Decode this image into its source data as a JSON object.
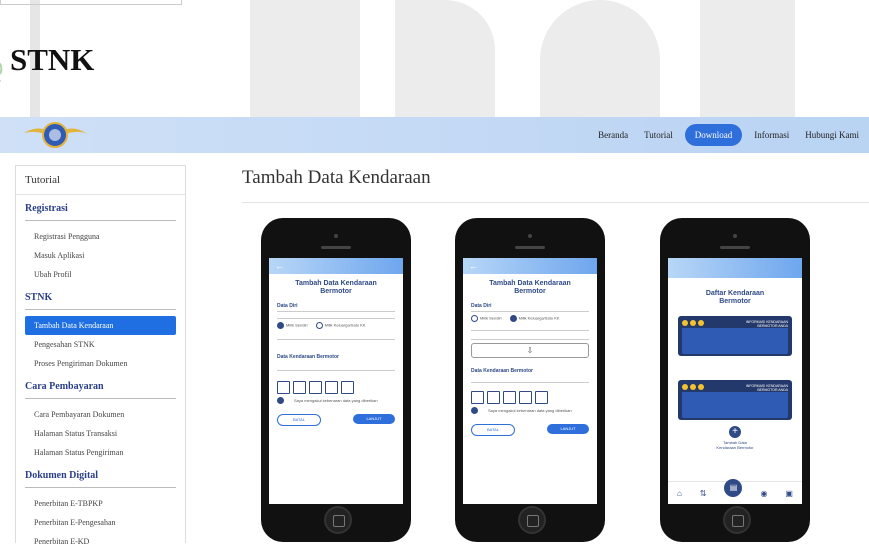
{
  "page": {
    "heading": "STNK",
    "watermark_text": "Sta"
  },
  "nav": {
    "items": [
      {
        "label": "Beranda",
        "active": false
      },
      {
        "label": "Tutorial",
        "active": false
      },
      {
        "label": "Download",
        "active": true
      },
      {
        "label": "Informasi",
        "active": false
      },
      {
        "label": "Hubungi Kami",
        "active": false
      }
    ]
  },
  "sidebar": {
    "header": "Tutorial",
    "sections": [
      {
        "title": "Registrasi",
        "items": [
          "Registrasi Pengguna",
          "Masuk Aplikasi",
          "Ubah Profil"
        ]
      },
      {
        "title": "STNK",
        "items": [
          "Tambah Data Kendaraan",
          "Pengesahan STNK",
          "Proses Pengiriman Dokumen"
        ]
      },
      {
        "title": "Cara Pembayaran",
        "items": [
          "Cara Pembayaran Dokumen",
          "Halaman Status Transaksi",
          "Halaman Status Pengiriman"
        ]
      },
      {
        "title": "Dokumen Digital",
        "items": [
          "Penerbitan E-TBPKP",
          "Penerbitan E-Pengesahan",
          "Penerbitan E-KD"
        ]
      }
    ],
    "active_item": "Tambah Data Kendaraan"
  },
  "main": {
    "title": "Tambah Data Kendaraan"
  },
  "phones": {
    "p1": {
      "title_l1": "Tambah Data Kendaraan",
      "title_l2": "Bermotor",
      "sec1": "Data Diri",
      "sec2": "Data Kendaraan Bermotor",
      "opt_a": "Milik Sendiri",
      "opt_b": "Milik Keluarga/Satu KK",
      "agree": "Saya mengakui kebenaran data yang diberikan",
      "btn_cancel": "BATAL",
      "btn_next": "LANJUT"
    },
    "p2": {
      "title_l1": "Tambah Data Kendaraan",
      "title_l2": "Bermotor",
      "sec1": "Data Diri",
      "sec2": "Data Kendaraan Bermotor",
      "opt_a": "Milik Sendiri",
      "opt_b": "Milik Keluarga/Satu KK",
      "agree": "Saya mengakui kebenaran data yang diberikan",
      "btn_cancel": "BATAL",
      "btn_next": "LANJUT"
    },
    "p3": {
      "title_l1": "Daftar Kendaraan",
      "title_l2": "Bermotor",
      "card_title": "INFORMASI KENDARAAN BERMOTOR ANDA",
      "add_l1": "Tambah Data",
      "add_l2": "Kendaraan Bermotor"
    }
  },
  "colors": {
    "accent": "#1f6fe3",
    "section": "#2a3f8a",
    "nav_bg": "#c6dbf5"
  }
}
